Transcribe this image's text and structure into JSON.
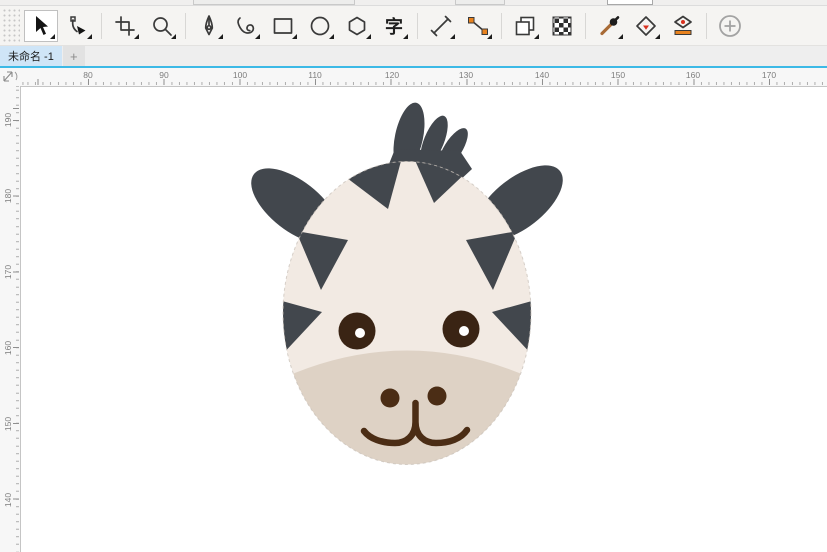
{
  "colors": {
    "accent_cyan": "#3cb9e6",
    "tab_active_bg": "#cfe5f7",
    "dark": "#42474d",
    "cream": "#f2eae3",
    "muzzle": "#ded2c5",
    "eye": "#3a2414",
    "mouth": "#4b2d15",
    "highlight": "#ffffff",
    "connector_orange": "#e8821e",
    "fill_red": "#d8301e"
  },
  "toolbar": {
    "text_tool_glyph": "字",
    "tools": [
      {
        "id": "pick-tool",
        "active": true,
        "flyout": true
      },
      {
        "id": "shape-tool",
        "active": false,
        "flyout": true
      },
      {
        "id": "crop-tool",
        "active": false,
        "flyout": true
      },
      {
        "id": "zoom-tool",
        "active": false,
        "flyout": true
      },
      {
        "id": "pen-tool",
        "active": false,
        "flyout": true
      },
      {
        "id": "bspline-tool",
        "active": false,
        "flyout": true
      },
      {
        "id": "rectangle-tool",
        "active": false,
        "flyout": true
      },
      {
        "id": "ellipse-tool",
        "active": false,
        "flyout": true
      },
      {
        "id": "polygon-tool",
        "active": false,
        "flyout": true
      },
      {
        "id": "text-tool",
        "active": false,
        "flyout": true
      },
      {
        "id": "dimension-tool",
        "active": false,
        "flyout": true
      },
      {
        "id": "connector-tool",
        "active": false,
        "flyout": true
      },
      {
        "id": "drop-shadow-tool",
        "active": false,
        "flyout": true
      },
      {
        "id": "transparency-tool",
        "active": false,
        "flyout": false
      },
      {
        "id": "eyedropper-tool",
        "active": false,
        "flyout": true
      },
      {
        "id": "interactive-fill-tool",
        "active": false,
        "flyout": true
      },
      {
        "id": "smart-fill-tool",
        "active": false,
        "flyout": false
      },
      {
        "id": "add-tools-button",
        "active": false,
        "flyout": false
      }
    ]
  },
  "tabbar": {
    "tabs": [
      {
        "label": "未命名 -1",
        "active": true
      }
    ],
    "new_tab_label": "+"
  },
  "rulers": {
    "horizontal": {
      "labels": [
        "80",
        "90",
        "100",
        "110",
        "120",
        "130",
        "140",
        "150",
        "160",
        "170"
      ]
    },
    "vertical": {
      "labels": [
        "190",
        "180",
        "170",
        "160",
        "150",
        "140"
      ]
    }
  },
  "canvas": {
    "illustration": "zebra-face"
  }
}
